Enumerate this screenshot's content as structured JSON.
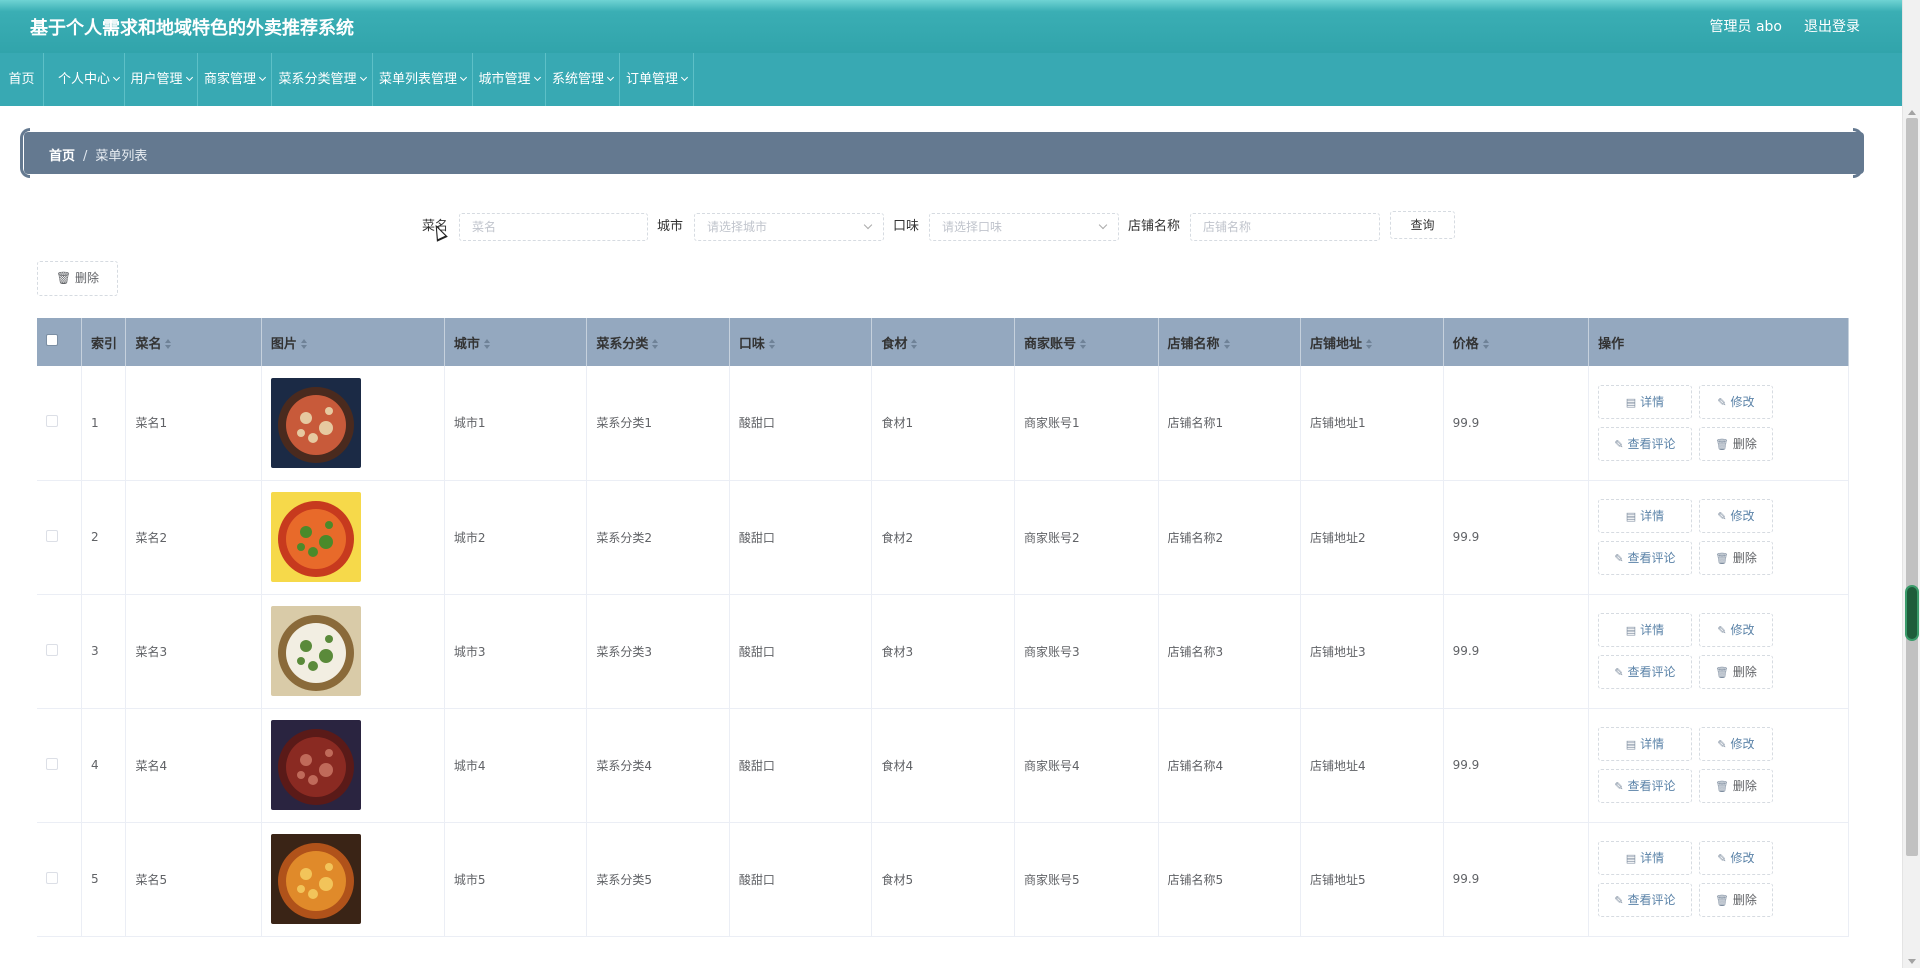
{
  "app": {
    "title": "基于个人需求和地域特色的外卖推荐系统"
  },
  "user": {
    "role_label": "管理员 abo",
    "logout_label": "退出登录"
  },
  "nav": [
    {
      "label": "首页",
      "dropdown": false
    },
    {
      "label": "个人中心",
      "dropdown": true
    },
    {
      "label": "用户管理",
      "dropdown": true
    },
    {
      "label": "商家管理",
      "dropdown": true
    },
    {
      "label": "菜系分类管理",
      "dropdown": true
    },
    {
      "label": "菜单列表管理",
      "dropdown": true
    },
    {
      "label": "城市管理",
      "dropdown": true
    },
    {
      "label": "系统管理",
      "dropdown": true
    },
    {
      "label": "订单管理",
      "dropdown": true
    }
  ],
  "breadcrumb": {
    "home": "首页",
    "sep": "/",
    "current": "菜单列表"
  },
  "filters": {
    "dish_label": "菜名",
    "dish_placeholder": "菜名",
    "city_label": "城市",
    "city_placeholder": "请选择城市",
    "taste_label": "口味",
    "taste_placeholder": "请选择口味",
    "shop_label": "店铺名称",
    "shop_placeholder": "店铺名称",
    "query_label": "查询"
  },
  "toolbar": {
    "delete_label": "删除"
  },
  "table": {
    "columns": [
      "索引",
      "菜名",
      "图片",
      "城市",
      "菜系分类",
      "口味",
      "食材",
      "商家账号",
      "店铺名称",
      "店铺地址",
      "价格",
      "操作"
    ],
    "actions": {
      "detail": "详情",
      "edit": "修改",
      "comments": "查看评论",
      "delete": "删除"
    },
    "rows": [
      {
        "index": "1",
        "name": "菜名1",
        "city": "城市1",
        "category": "菜系分类1",
        "taste": "酸甜口",
        "ingredient": "食材1",
        "account": "商家账号1",
        "shop": "店铺名称1",
        "address": "店铺地址1",
        "price": "99.9",
        "food": "bowl-nuts"
      },
      {
        "index": "2",
        "name": "菜名2",
        "city": "城市2",
        "category": "菜系分类2",
        "taste": "酸甜口",
        "ingredient": "食材2",
        "account": "商家账号2",
        "shop": "店铺名称2",
        "address": "店铺地址2",
        "price": "99.9",
        "food": "fish-soup"
      },
      {
        "index": "3",
        "name": "菜名3",
        "city": "城市3",
        "category": "菜系分类3",
        "taste": "酸甜口",
        "ingredient": "食材3",
        "account": "商家账号3",
        "shop": "店铺名称3",
        "address": "店铺地址3",
        "price": "99.9",
        "food": "mushroom-stew"
      },
      {
        "index": "4",
        "name": "菜名4",
        "city": "城市4",
        "category": "菜系分类4",
        "taste": "酸甜口",
        "ingredient": "食材4",
        "account": "商家账号4",
        "shop": "店铺名称4",
        "address": "店铺地址4",
        "price": "99.9",
        "food": "braised-pork"
      },
      {
        "index": "5",
        "name": "菜名5",
        "city": "城市5",
        "category": "菜系分类5",
        "taste": "酸甜口",
        "ingredient": "食材5",
        "account": "商家账号5",
        "shop": "店铺名称5",
        "address": "店铺地址5",
        "price": "99.9",
        "food": "stir-fry"
      }
    ]
  },
  "colors": {
    "header": "#31a4ab",
    "breadcrumb": "#647990",
    "table_header": "#94a8bf"
  }
}
